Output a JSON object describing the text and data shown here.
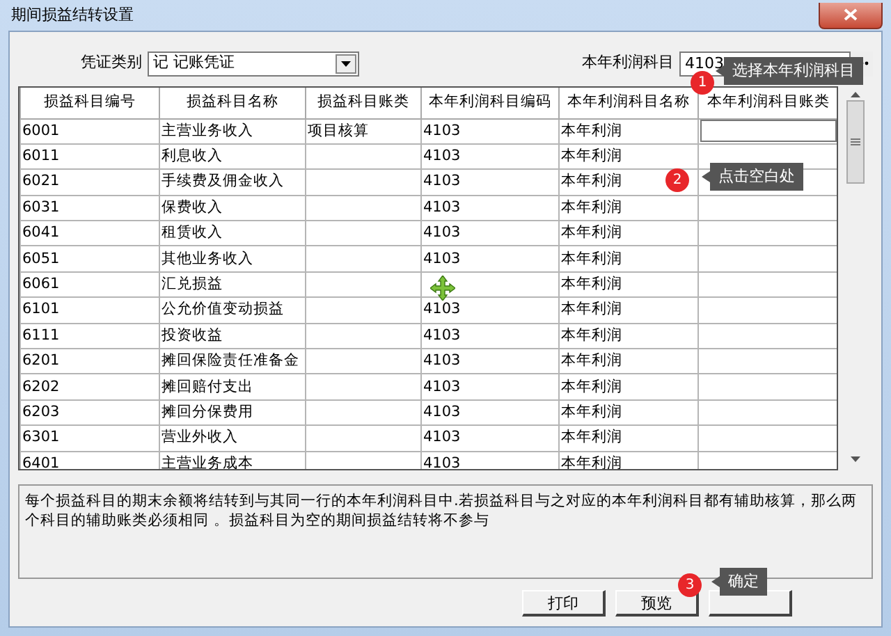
{
  "window": {
    "title": "期间损益结转设置"
  },
  "voucher_type": {
    "label": "凭证类别",
    "value": "记  记账凭证"
  },
  "profit_account": {
    "label": "本年利润科目",
    "value": "4103"
  },
  "table": {
    "columns": [
      "损益科目编号",
      "损益科目名称",
      "损益科目账类",
      "本年利润科目编码",
      "本年利润科目名称",
      "本年利润科目账类"
    ],
    "rows": [
      {
        "cells": [
          "6001",
          "主营业务收入",
          "项目核算",
          "4103",
          "本年利润",
          ""
        ],
        "editing": true
      },
      {
        "cells": [
          "6011",
          "利息收入",
          "",
          "4103",
          "本年利润",
          ""
        ],
        "editing": false
      },
      {
        "cells": [
          "6021",
          "手续费及佣金收入",
          "",
          "4103",
          "本年利润",
          ""
        ],
        "editing": false
      },
      {
        "cells": [
          "6031",
          "保费收入",
          "",
          "4103",
          "本年利润",
          ""
        ],
        "editing": false
      },
      {
        "cells": [
          "6041",
          "租赁收入",
          "",
          "4103",
          "本年利润",
          ""
        ],
        "editing": false
      },
      {
        "cells": [
          "6051",
          "其他业务收入",
          "",
          "4103",
          "本年利润",
          ""
        ],
        "editing": false
      },
      {
        "cells": [
          "6061",
          "汇兑损益",
          "",
          "",
          "本年利润",
          ""
        ],
        "editing": false
      },
      {
        "cells": [
          "6101",
          "公允价值变动损益",
          "",
          "4103",
          "本年利润",
          ""
        ],
        "editing": false
      },
      {
        "cells": [
          "6111",
          "投资收益",
          "",
          "4103",
          "本年利润",
          ""
        ],
        "editing": false
      },
      {
        "cells": [
          "6201",
          "摊回保险责任准备金",
          "",
          "4103",
          "本年利润",
          ""
        ],
        "editing": false
      },
      {
        "cells": [
          "6202",
          "摊回赔付支出",
          "",
          "4103",
          "本年利润",
          ""
        ],
        "editing": false
      },
      {
        "cells": [
          "6203",
          "摊回分保费用",
          "",
          "4103",
          "本年利润",
          ""
        ],
        "editing": false
      },
      {
        "cells": [
          "6301",
          "营业外收入",
          "",
          "4103",
          "本年利润",
          ""
        ],
        "editing": false
      },
      {
        "cells": [
          "6401",
          "主营业务成本",
          "",
          "4103",
          "本年利润",
          ""
        ],
        "editing": false
      }
    ]
  },
  "description": "每个损益科目的期末余额将结转到与其同一行的本年利润科目中.若损益科目与之对应的本年利润科目都有辅助核算，那么两个科目的辅助账类必须相同   。损益科目为空的期间损益结转将不参与",
  "buttons": [
    "打印",
    "预览"
  ],
  "callouts": [
    {
      "number": "1",
      "text": "选择本年利润科目"
    },
    {
      "number": "2",
      "text": "点击空白处"
    },
    {
      "number": "3",
      "text": "确定"
    }
  ]
}
